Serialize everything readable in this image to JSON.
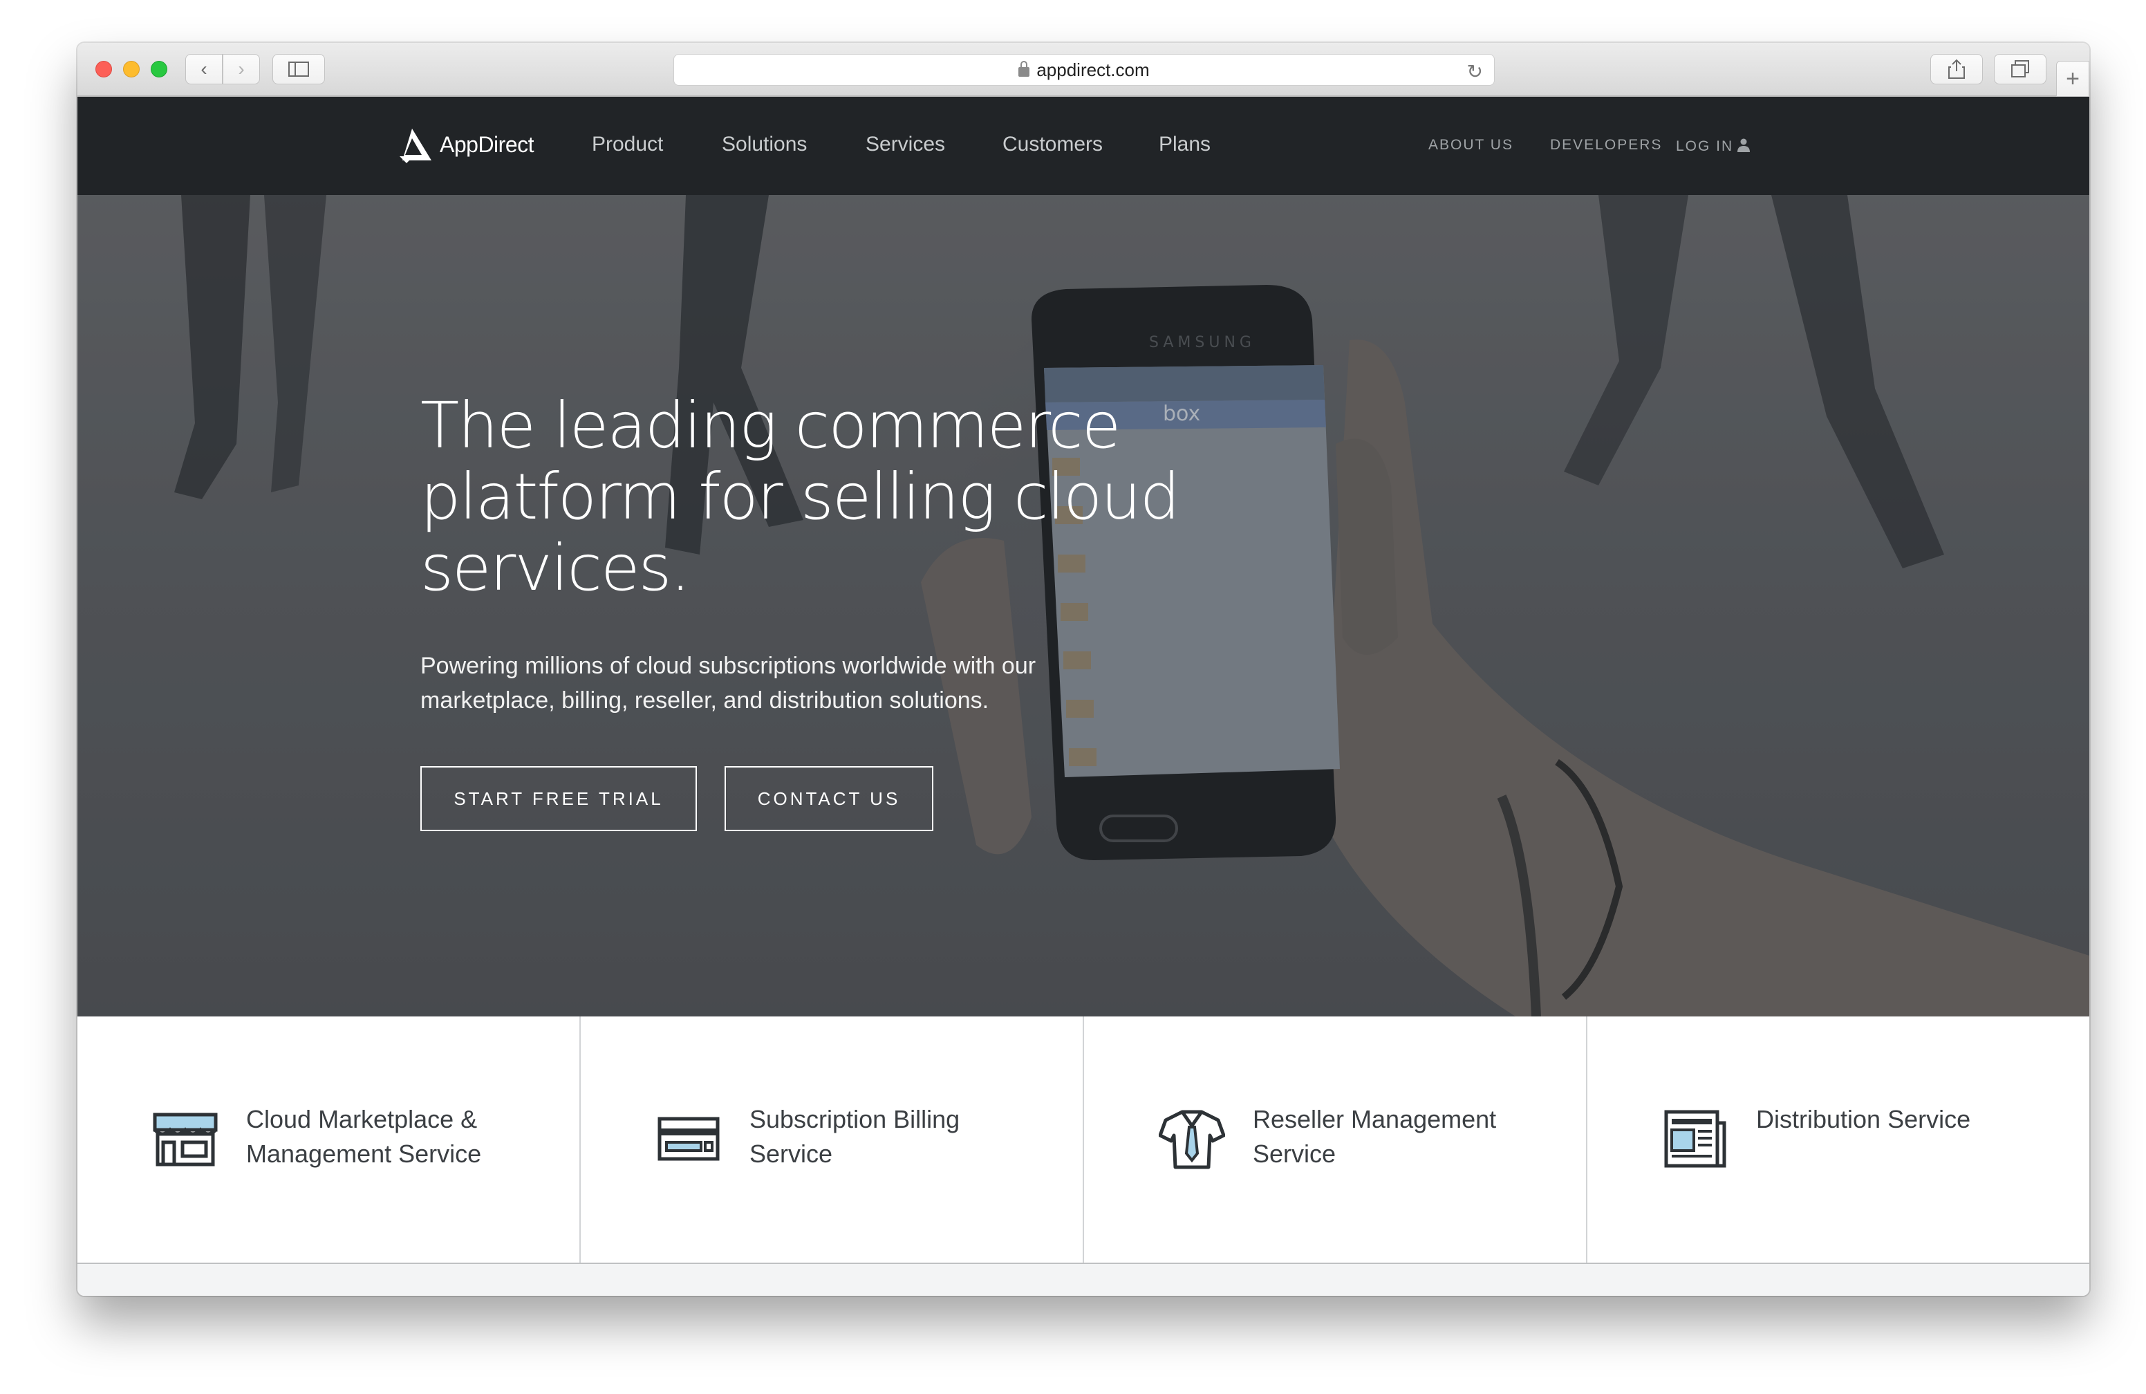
{
  "browser": {
    "url": "appdirect.com",
    "icons": {
      "back": "chevron-left-icon",
      "forward": "chevron-right-icon",
      "sidebar": "sidebar-icon",
      "share": "share-icon",
      "tabs": "tabs-icon",
      "new_tab": "plus-icon",
      "reload": "reload-icon",
      "lock": "lock-icon"
    }
  },
  "site": {
    "logo_text": "AppDirect",
    "nav": [
      "Product",
      "Solutions",
      "Services",
      "Customers",
      "Plans"
    ],
    "util_nav": {
      "about": "ABOUT US",
      "developers": "DEVELOPERS",
      "login": "LOG IN"
    },
    "colors": {
      "nav_bg": "#212427",
      "text_dark": "#3b3f43"
    }
  },
  "hero": {
    "title": "The leading commerce platform for selling cloud services.",
    "subtitle": "Powering millions of cloud subscriptions worldwide with our marketplace, billing, reseller, and distribution solutions.",
    "cta_trial": "START FREE TRIAL",
    "cta_contact": "CONTACT US"
  },
  "features": [
    {
      "label": "Cloud Marketplace & Management Service",
      "icon": "storefront-icon"
    },
    {
      "label": "Subscription Billing Service",
      "icon": "credit-card-icon"
    },
    {
      "label": "Reseller Management Service",
      "icon": "shirt-tie-icon"
    },
    {
      "label": "Distribution Service",
      "icon": "newspaper-icon"
    }
  ]
}
